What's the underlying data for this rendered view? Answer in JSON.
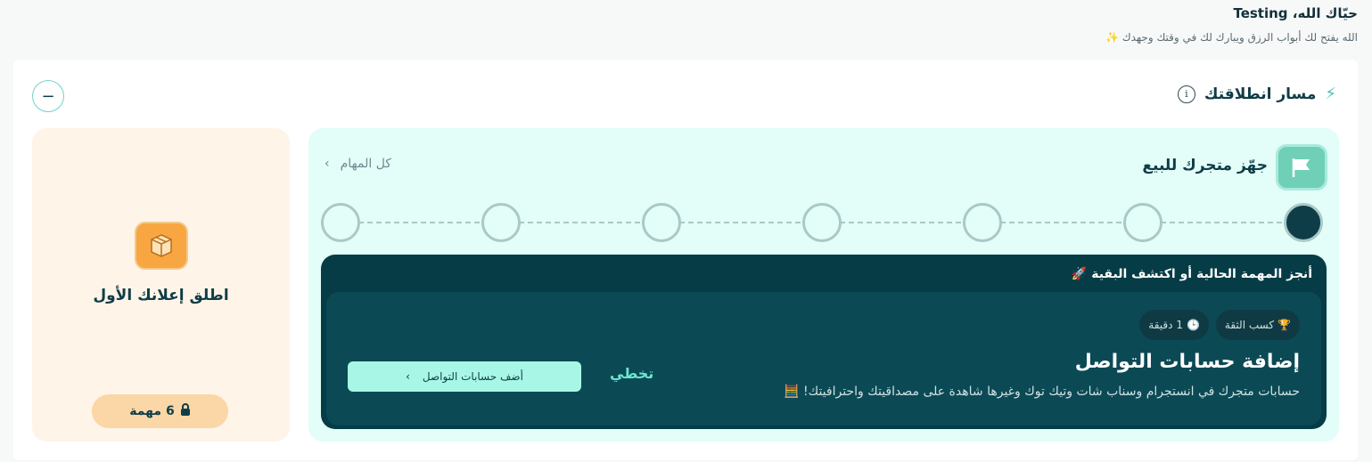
{
  "greeting": {
    "title": "حيّاك الله، Testing",
    "subtitle": "الله يفتح لك أبواب الرزق ويبارك لك في وقتك وجهدك ✨"
  },
  "section": {
    "title": "مسار انطلاقتك",
    "icon": "bolt-icon",
    "info_icon": "info-icon",
    "collapse_icon": "minus-icon"
  },
  "side_card": {
    "icon": "box-icon",
    "title": "اطلق إعلانك الأول",
    "tasks_label": "6 مهمة",
    "lock_icon": "lock-icon"
  },
  "main_card": {
    "icon": "flag-icon",
    "title": "جهّز متجرك للبيع",
    "all_tasks_label": "كل المهام",
    "steps_total": 7,
    "steps_completed": 1,
    "prompt": "أنجز المهمة الحالية أو اكتشف البقية 🚀",
    "task": {
      "badge_trust": "كسب الثقة",
      "badge_time": "1 دقيقة",
      "title": "إضافة حسابات التواصل",
      "description": "حسابات متجرك في انستجرام وسناب شات وتيك توك وغيرها شاهدة على مصداقيتك واحترافيتك! 🧮",
      "skip_label": "تخطي",
      "cta_label": "أضف حسابات التواصل"
    }
  },
  "colors": {
    "accent": "#6fd4c7",
    "dark": "#063c46",
    "mint_bg": "#e3fdf8",
    "peach_bg": "#fff4e8"
  }
}
